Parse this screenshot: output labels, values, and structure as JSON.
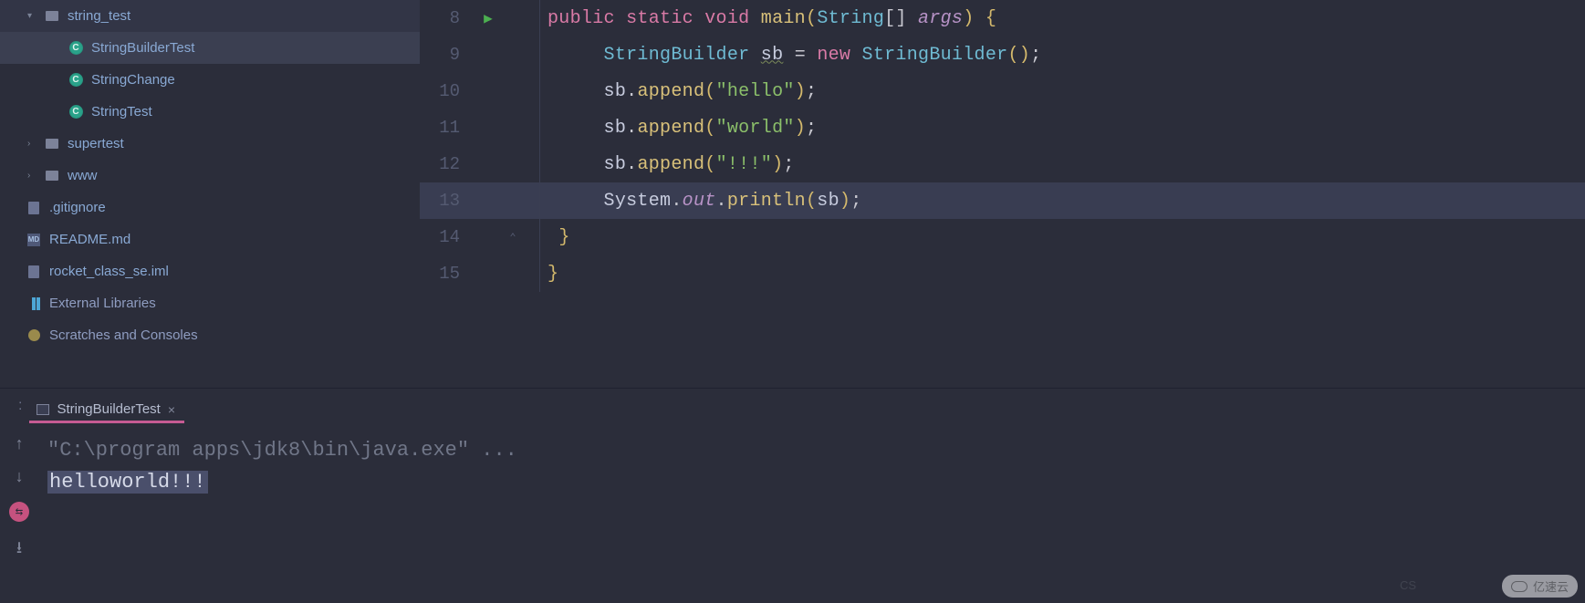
{
  "sidebar": {
    "items": [
      {
        "chevron": "▾",
        "iconType": "folder",
        "label": "string_test",
        "indent": 1,
        "selected": false
      },
      {
        "chevron": "",
        "iconType": "class",
        "label": "StringBuilderTest",
        "indent": 2,
        "selected": true
      },
      {
        "chevron": "",
        "iconType": "class",
        "label": "StringChange",
        "indent": 2,
        "selected": false
      },
      {
        "chevron": "",
        "iconType": "class",
        "label": "StringTest",
        "indent": 2,
        "selected": false
      },
      {
        "chevron": "›",
        "iconType": "folder",
        "label": "supertest",
        "indent": 1,
        "selected": false
      },
      {
        "chevron": "›",
        "iconType": "folder",
        "label": "www",
        "indent": 1,
        "selected": false
      },
      {
        "chevron": "",
        "iconType": "file",
        "label": ".gitignore",
        "indent": 0,
        "selected": false
      },
      {
        "chevron": "",
        "iconType": "md",
        "label": "README.md",
        "indent": 0,
        "selected": false
      },
      {
        "chevron": "",
        "iconType": "file",
        "label": "rocket_class_se.iml",
        "indent": 0,
        "selected": false
      },
      {
        "chevron": "",
        "iconType": "lib",
        "label": "External Libraries",
        "indent": 0,
        "selected": false
      },
      {
        "chevron": "",
        "iconType": "scratch",
        "label": "Scratches and Consoles",
        "indent": 0,
        "selected": false
      }
    ]
  },
  "editor": {
    "lines": {
      "l8": {
        "num": "8",
        "sig_kw1": "public",
        "sig_kw2": "static",
        "sig_kw3": "void",
        "sig_name": "main",
        "sig_type": "String",
        "sig_param": "args"
      },
      "l9": {
        "num": "9",
        "type": "StringBuilder",
        "var": "sb",
        "op": "=",
        "kw": "new",
        "ctor": "StringBuilder"
      },
      "l10": {
        "num": "10",
        "obj": "sb",
        "meth": "append",
        "str": "\"hello\""
      },
      "l11": {
        "num": "11",
        "obj": "sb",
        "meth": "append",
        "str": "\"world\""
      },
      "l12": {
        "num": "12",
        "obj": "sb",
        "meth": "append",
        "str": "\"!!!\""
      },
      "l13": {
        "num": "13",
        "cls": "System",
        "field": "out",
        "meth": "println",
        "arg": "sb"
      },
      "l14": {
        "num": "14"
      },
      "l15": {
        "num": "15"
      }
    }
  },
  "runPanel": {
    "tabTitle": "StringBuilderTest",
    "closeGlyph": "×",
    "cmd": "\"C:\\program apps\\jdk8\\bin\\java.exe\" ...",
    "output": "helloworld!!!"
  },
  "watermark": {
    "cs": "CS",
    "brand": "亿速云"
  }
}
